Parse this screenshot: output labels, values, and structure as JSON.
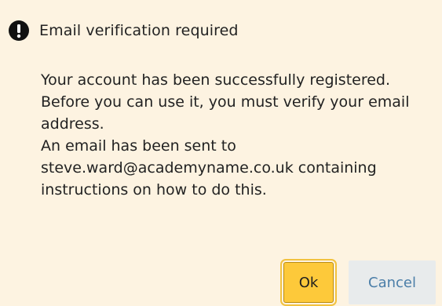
{
  "dialog": {
    "title": "Email verification required",
    "message_lines": [
      "Your account has been successfully registered.",
      "Before you can use it, you must verify your email address.",
      "An email has been sent to steve.ward@academyname.co.uk containing instructions on how to do this."
    ],
    "ok_label": "Ok",
    "cancel_label": "Cancel"
  },
  "colors": {
    "background": "#fdf3e1",
    "ok_button": "#fdc93a",
    "cancel_button_bg": "#e8ebec",
    "cancel_text": "#4b7ea8"
  },
  "icons": {
    "header_icon": "exclamation-circle-icon"
  }
}
